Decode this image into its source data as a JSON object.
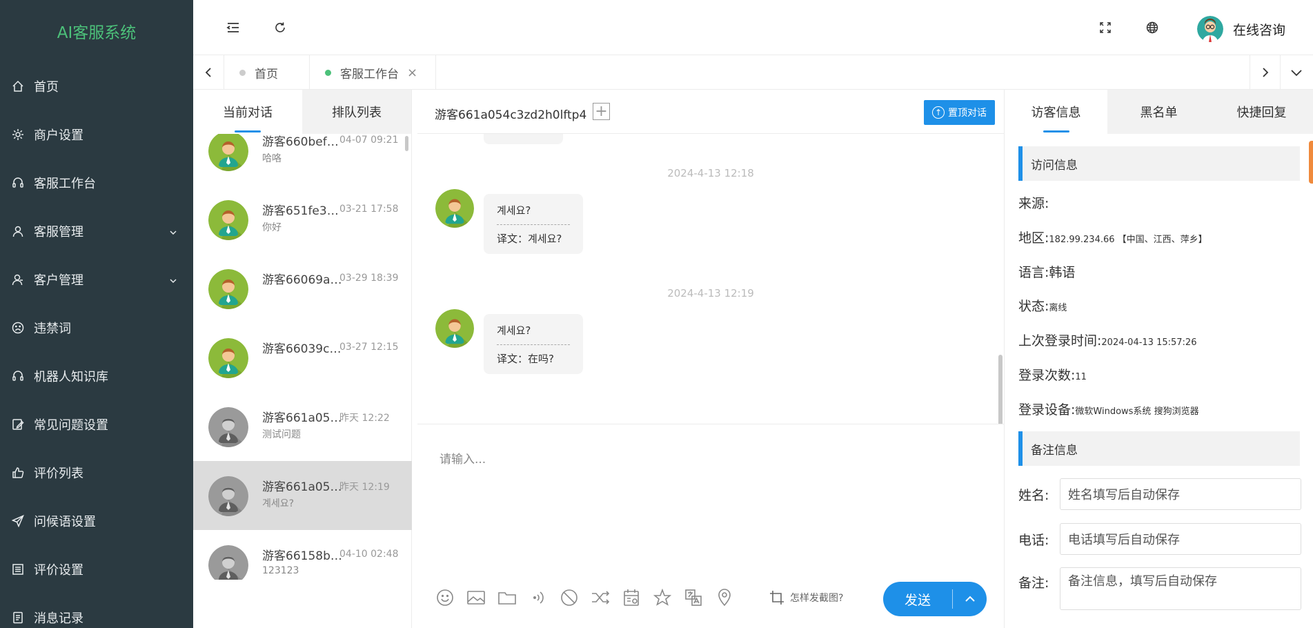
{
  "app": {
    "title": "AI客服系统"
  },
  "sidebar": {
    "items": [
      {
        "label": "首页",
        "icon": "home-icon"
      },
      {
        "label": "商户设置",
        "icon": "gear-icon"
      },
      {
        "label": "客服工作台",
        "icon": "headset-icon"
      },
      {
        "label": "客服管理",
        "icon": "user-icon",
        "expandable": true
      },
      {
        "label": "客户管理",
        "icon": "users-icon",
        "expandable": true
      },
      {
        "label": "违禁词",
        "icon": "frown-icon"
      },
      {
        "label": "机器人知识库",
        "icon": "headset-icon"
      },
      {
        "label": "常见问题设置",
        "icon": "edit-icon"
      },
      {
        "label": "评价列表",
        "icon": "thumbs-up-icon"
      },
      {
        "label": "问候语设置",
        "icon": "send-icon"
      },
      {
        "label": "评价设置",
        "icon": "list-icon"
      },
      {
        "label": "消息记录",
        "icon": "document-icon"
      }
    ]
  },
  "header": {
    "user_name": "在线咨询"
  },
  "tabs": [
    {
      "label": "首页",
      "dot_color": "#cccccc"
    },
    {
      "label": "客服工作台",
      "dot_color": "#4cc17a",
      "close": "×"
    }
  ],
  "conversations": {
    "tabs": [
      "当前对话",
      "排队列表"
    ],
    "items": [
      {
        "name": "游客660bef79...",
        "time": "04-07 09:21",
        "message": "哈咯",
        "avatar": "online"
      },
      {
        "name": "游客651fe3d5...",
        "time": "03-21 17:58",
        "message": "你好",
        "avatar": "online"
      },
      {
        "name": "游客66069a3...",
        "time": "03-29 18:39",
        "message": "",
        "avatar": "online"
      },
      {
        "name": "游客66039cd...",
        "time": "03-27 12:15",
        "message": "",
        "avatar": "online"
      },
      {
        "name": "游客661a05a...",
        "time": "昨天 12:22",
        "message": "测试问题",
        "avatar": "offline"
      },
      {
        "name": "游客661a054...",
        "time": "昨天 12:19",
        "message": "계세요?",
        "avatar": "offline",
        "selected": true
      },
      {
        "name": "游客66158b7f...",
        "time": "04-10 02:48",
        "message": "123123",
        "avatar": "offline"
      }
    ]
  },
  "chat": {
    "title": "游客661a054c3zd2h0lftp4",
    "pin_label": "置顶对话",
    "messages": [
      {
        "timestamp": "2024-4-13 12:18",
        "original": "계세요?",
        "translation": "译文：계세요?"
      },
      {
        "timestamp": "2024-4-13 12:19",
        "original": "계세요?",
        "translation": "译文：在吗?"
      }
    ],
    "input_placeholder": "请输入...",
    "screenshot_hint": "怎样发截图?",
    "send_label": "发送",
    "tools": [
      "emoji-icon",
      "image-icon",
      "folder-icon",
      "voice-icon",
      "block-icon",
      "transfer-icon",
      "calendar-icon",
      "star-icon",
      "translate-icon",
      "location-icon"
    ]
  },
  "visitor": {
    "tabs": [
      "访客信息",
      "黑名单",
      "快捷回复"
    ],
    "section_visit": "访问信息",
    "rows": [
      {
        "label": "来源:",
        "value": ""
      },
      {
        "label": "地区:",
        "value": "182.99.234.66 【中国、江西、萍乡】"
      },
      {
        "label": "语言:",
        "value": "韩语"
      },
      {
        "label": "状态:",
        "value": "离线"
      },
      {
        "label": "上次登录时间:",
        "value": "2024-04-13 15:57:26"
      },
      {
        "label": "登录次数:",
        "value": "11"
      },
      {
        "label": "登录设备:",
        "value": "微软Windows系统 搜狗浏览器"
      }
    ],
    "section_notes": "备注信息",
    "fields": [
      {
        "label": "姓名:",
        "placeholder": "姓名填写后自动保存"
      },
      {
        "label": "电话:",
        "placeholder": "电话填写后自动保存"
      },
      {
        "label": "备注:",
        "placeholder": "备注信息，填写后自动保存"
      }
    ]
  },
  "colors": {
    "sidebar_bg": "#2b3a41",
    "brand": "#4cc17a",
    "accent": "#1e90e8"
  }
}
